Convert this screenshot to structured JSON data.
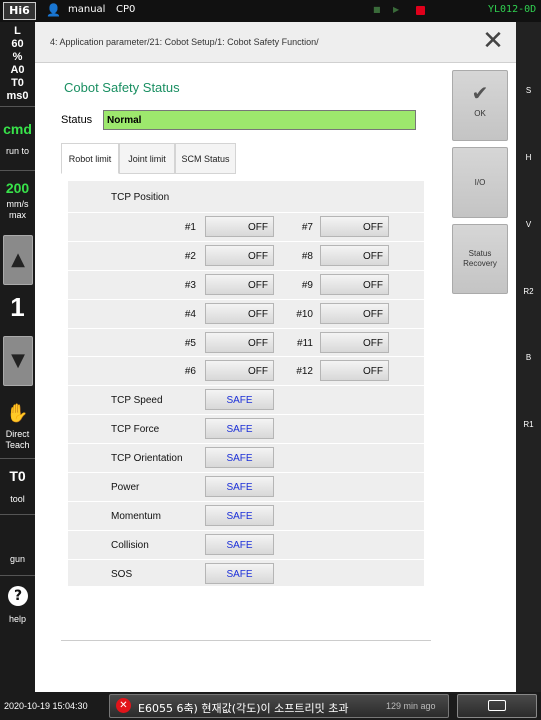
{
  "topbar": {
    "logo": "Hi6",
    "mode": "manual",
    "cp": "CP0",
    "version": "YL012-0D",
    "tiny_marks": [
      "■",
      "▶",
      "■"
    ]
  },
  "leftbar": {
    "status_lines": [
      "L",
      "60",
      "%",
      "A0",
      "T0",
      "ms0"
    ],
    "cmd": "cmd",
    "run_to": "run to",
    "speed": "200",
    "speed_unit": "mm/s",
    "speed_mode": "max",
    "up_icon": "▲",
    "step": "1",
    "down_icon": "▼",
    "direct_teach": [
      "Direct",
      "Teach"
    ],
    "tool_value": "T0",
    "tool_label": "tool",
    "gun_label": "gun",
    "help_icon": "?",
    "help_label": "help"
  },
  "rightbar": {
    "labels": [
      "S",
      "H",
      "V",
      "R2",
      "B",
      "R1"
    ]
  },
  "header": {
    "breadcrumb": "4: Application parameter/21: Cobot Setup/1: Cobot Safety Function/",
    "close_icon": "✕"
  },
  "panel": {
    "title": "Cobot Safety Status",
    "status_label": "Status",
    "status_value": "Normal",
    "status_color": "#9de86d",
    "tabs": [
      {
        "label": "Robot limit",
        "active": true
      },
      {
        "label": "Joint limit",
        "active": false
      },
      {
        "label": "SCM Status",
        "active": false
      }
    ],
    "tcp_position_label": "TCP Position",
    "tcp_positions": [
      {
        "left_id": "#1",
        "left_value": "OFF",
        "right_id": "#7",
        "right_value": "OFF"
      },
      {
        "left_id": "#2",
        "left_value": "OFF",
        "right_id": "#8",
        "right_value": "OFF"
      },
      {
        "left_id": "#3",
        "left_value": "OFF",
        "right_id": "#9",
        "right_value": "OFF"
      },
      {
        "left_id": "#4",
        "left_value": "OFF",
        "right_id": "#10",
        "right_value": "OFF"
      },
      {
        "left_id": "#5",
        "left_value": "OFF",
        "right_id": "#11",
        "right_value": "OFF"
      },
      {
        "left_id": "#6",
        "left_value": "OFF",
        "right_id": "#12",
        "right_value": "OFF"
      }
    ],
    "limits": [
      {
        "label": "TCP Speed",
        "value": "SAFE"
      },
      {
        "label": "TCP Force",
        "value": "SAFE"
      },
      {
        "label": "TCP Orientation",
        "value": "SAFE"
      },
      {
        "label": "Power",
        "value": "SAFE"
      },
      {
        "label": "Momentum",
        "value": "SAFE"
      },
      {
        "label": "Collision",
        "value": "SAFE"
      },
      {
        "label": "SOS",
        "value": "SAFE"
      }
    ]
  },
  "side_buttons": {
    "ok_icon": "✔",
    "ok": "OK",
    "io": "I/O",
    "status_recovery": [
      "Status",
      "Recovery"
    ]
  },
  "bottombar": {
    "datetime": "2020-10-19 15:04:30",
    "alarm_icon": "✕",
    "alarm_text": "E6055 6축) 현재값(각도)이 소프트리밋 초과",
    "alarm_age": "129 min ago",
    "keyboard_icon": "keyboard-icon"
  }
}
